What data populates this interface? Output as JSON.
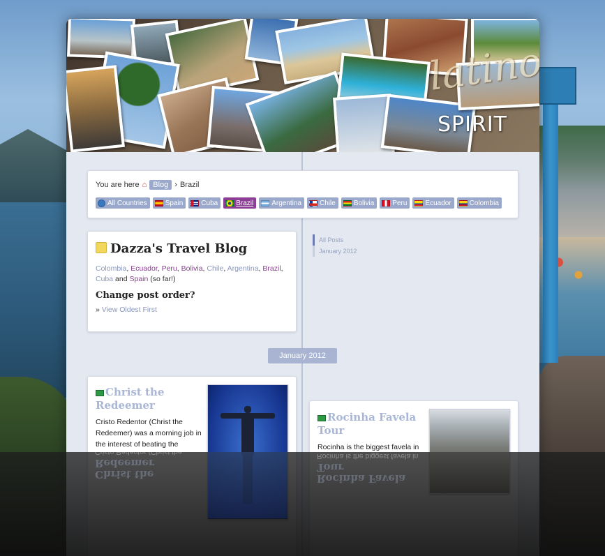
{
  "banner": {
    "logo_script": "latino",
    "logo_word": "SPIRIT"
  },
  "breadcrumb": {
    "you_are_here": "You are here",
    "crumbs": [
      "Blog",
      "Brazil"
    ],
    "separator": "›"
  },
  "countries": [
    {
      "label": "All Countries",
      "icon": "globe-icon",
      "active": false
    },
    {
      "label": "Spain",
      "icon": "flag-spain",
      "active": false
    },
    {
      "label": "Cuba",
      "icon": "flag-cuba",
      "active": false
    },
    {
      "label": "Brazil",
      "icon": "flag-brazil",
      "active": true
    },
    {
      "label": "Argentina",
      "icon": "flag-argentina",
      "active": false
    },
    {
      "label": "Chile",
      "icon": "flag-chile",
      "active": false
    },
    {
      "label": "Bolivia",
      "icon": "flag-bolivia",
      "active": false
    },
    {
      "label": "Peru",
      "icon": "flag-peru",
      "active": false
    },
    {
      "label": "Ecuador",
      "icon": "flag-ecuador",
      "active": false
    },
    {
      "label": "Colombia",
      "icon": "flag-colombia",
      "active": false
    }
  ],
  "blog_card": {
    "title": "Dazza's Travel Blog",
    "country_links": [
      "Colombia",
      "Ecuador",
      "Peru",
      "Bolivia",
      "Chile",
      "Argentina",
      "Brazil",
      "Cuba"
    ],
    "and_word": "and",
    "last_country": "Spain",
    "suffix": "(so far!)",
    "order_heading": "Change post order?",
    "order_prefix": "»",
    "order_link": "View Oldest First"
  },
  "side_nav": {
    "items": [
      "All Posts",
      "January 2012"
    ]
  },
  "timeline": {
    "month_label": "January 2012"
  },
  "posts": [
    {
      "title": "Christ the Redeemer",
      "excerpt_lines": [
        "Cristo Redentor (Christ the",
        "Redeemer) was a morning job in",
        "the interest of beating the"
      ],
      "image_alt": "christ-the-redeemer-statue"
    },
    {
      "title": "Rocinha Favela Tour",
      "excerpt_lines": [
        "Rocinha is the biggest favela in"
      ],
      "image_alt": "rocinha-favela"
    }
  ],
  "colors": {
    "accent": "#9aa8cc",
    "active_country": "#8b3f94",
    "link": "#8a97be",
    "post_title": "#a9b6d6"
  }
}
